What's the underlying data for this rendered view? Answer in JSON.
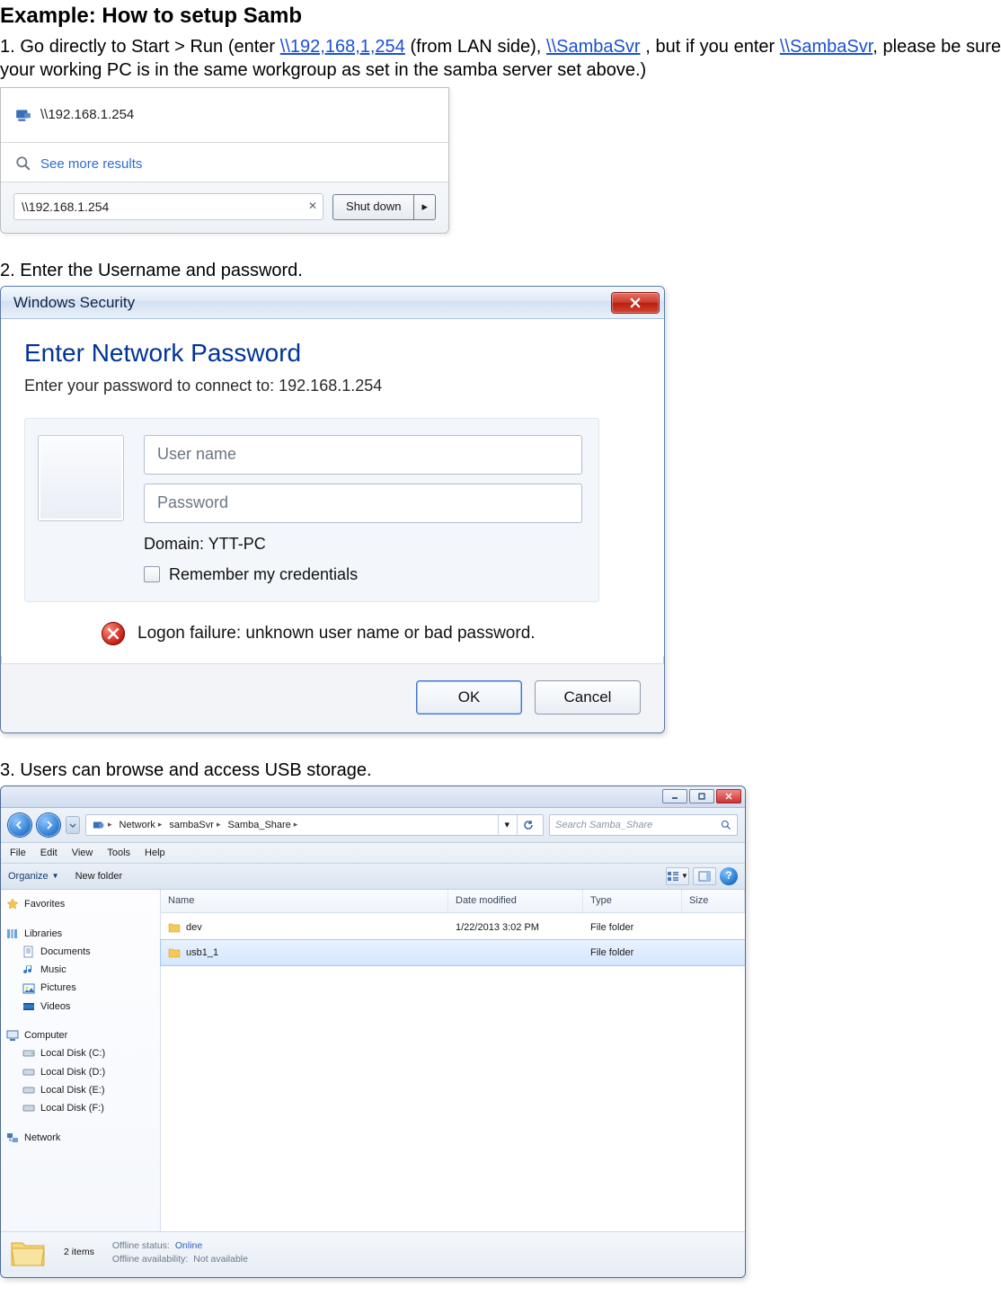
{
  "doc": {
    "title": "Example: How to setup Samb",
    "step1_a": "1. Go directly to Start > Run (enter ",
    "step1_link1": "\\\\192,168,1,254",
    "step1_b": " (from LAN side), ",
    "step1_link2": "\\\\SambaSvr",
    "step1_c": " , but if you enter ",
    "step1_link3": "\\\\SambaSvr",
    "step1_d": ", please be sure your working PC is in the same workgroup as set in the samba server set above.)",
    "step2": "2. Enter the Username and password.",
    "step3": "3. Users can browse and access USB storage."
  },
  "startmenu": {
    "result_label": "\\\\192.168.1.254",
    "see_more": "See more results",
    "search_value": "\\\\192.168.1.254",
    "shutdown_label": "Shut down"
  },
  "dialog": {
    "title": "Windows Security",
    "heading": "Enter Network Password",
    "subtext": "Enter your password to connect to: 192.168.1.254",
    "username_placeholder": "User name",
    "password_placeholder": "Password",
    "domain_line": "Domain: YTT-PC",
    "remember_label": "Remember my credentials",
    "error_text": "Logon failure: unknown user name or bad password.",
    "ok": "OK",
    "cancel": "Cancel"
  },
  "explorer": {
    "breadcrumb": [
      "Network",
      "sambaSvr",
      "Samba_Share"
    ],
    "search_placeholder": "Search Samba_Share",
    "menubar": [
      "File",
      "Edit",
      "View",
      "Tools",
      "Help"
    ],
    "organize": "Organize",
    "newfolder": "New folder",
    "columns": {
      "name": "Name",
      "date": "Date modified",
      "type": "Type",
      "size": "Size"
    },
    "rows": [
      {
        "name": "dev",
        "date": "1/22/2013 3:02 PM",
        "type": "File folder",
        "size": ""
      },
      {
        "name": "usb1_1",
        "date": "",
        "type": "File folder",
        "size": ""
      }
    ],
    "sidebar": {
      "favorites": "Favorites",
      "libraries": "Libraries",
      "lib_items": [
        "Documents",
        "Music",
        "Pictures",
        "Videos"
      ],
      "computer": "Computer",
      "drives": [
        "Local Disk (C:)",
        "Local Disk (D:)",
        "Local Disk (E:)",
        "Local Disk (F:)"
      ],
      "network": "Network"
    },
    "status": {
      "count": "2 items",
      "offline_status_label": "Offline status:",
      "offline_status_value": "Online",
      "offline_avail_label": "Offline availability:",
      "offline_avail_value": "Not available"
    }
  }
}
